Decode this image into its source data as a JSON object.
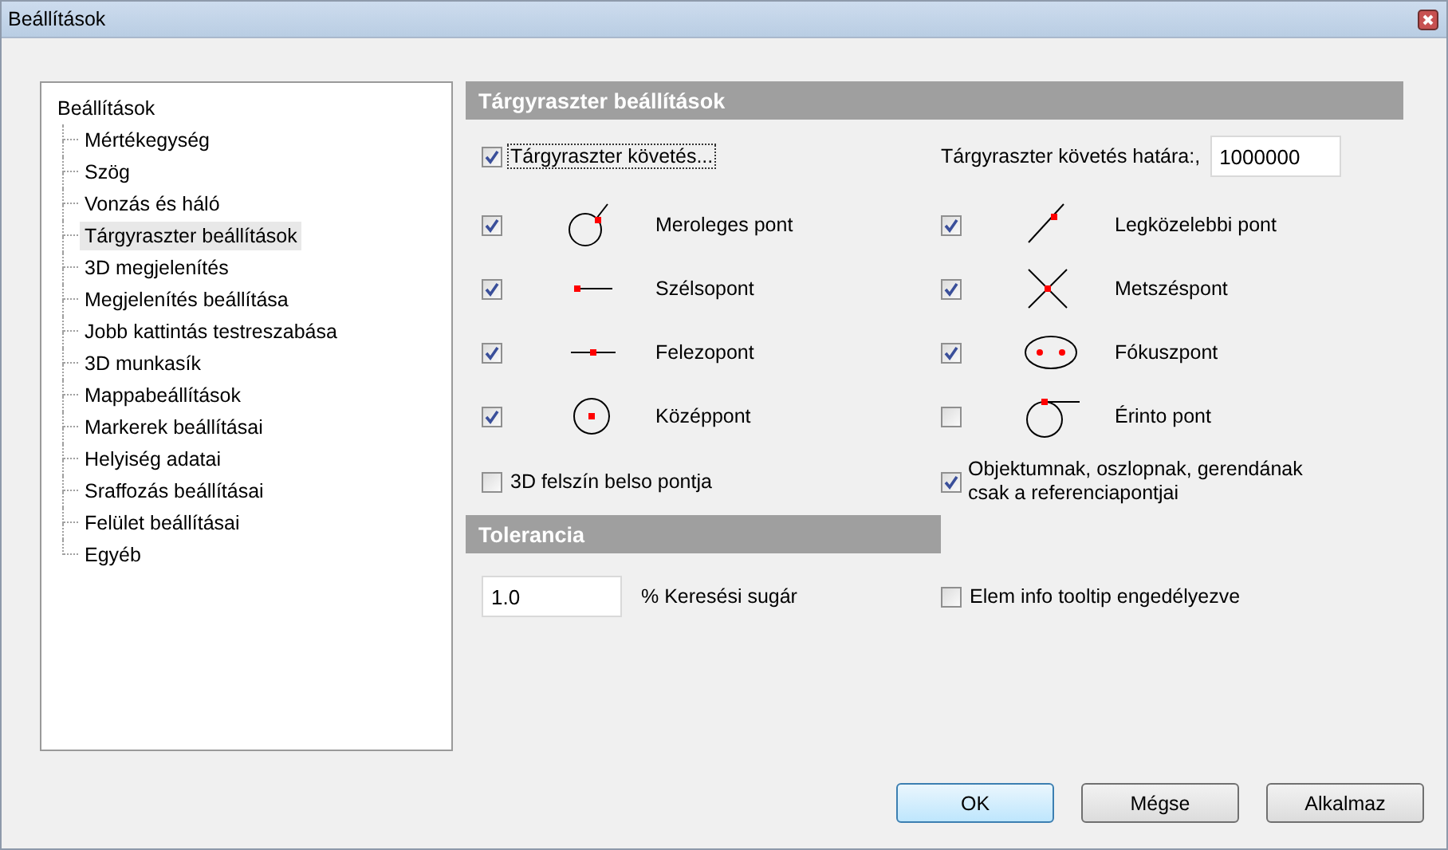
{
  "window": {
    "title": "Beállítások"
  },
  "tree": {
    "root": "Beállítások",
    "children": [
      {
        "label": "Mértékegység",
        "selected": false
      },
      {
        "label": "Szög",
        "selected": false
      },
      {
        "label": "Vonzás és háló",
        "selected": false
      },
      {
        "label": "Tárgyraszter beállítások",
        "selected": true
      },
      {
        "label": "3D megjelenítés",
        "selected": false
      },
      {
        "label": "Megjelenítés beállítása",
        "selected": false
      },
      {
        "label": "Jobb kattintás testreszabása",
        "selected": false
      },
      {
        "label": "3D munkasík",
        "selected": false
      },
      {
        "label": "Mappabeállítások",
        "selected": false
      },
      {
        "label": "Markerek beállításai",
        "selected": false
      },
      {
        "label": "Helyiség adatai",
        "selected": false
      },
      {
        "label": "Sraffozás beállításai",
        "selected": false
      },
      {
        "label": "Felület beállításai",
        "selected": false
      },
      {
        "label": "Egyéb",
        "selected": false
      }
    ]
  },
  "snap": {
    "title": "Tárgyraszter beállítások",
    "tracking": {
      "label": "Tárgyraszter követés...",
      "checked": true,
      "focused": true
    },
    "limit": {
      "label": "Tárgyraszter követés határa:,",
      "value": "1000000"
    },
    "left": [
      {
        "kind": "perpendicular",
        "label": "Meroleges pont",
        "checked": true
      },
      {
        "kind": "endpoint",
        "label": "Szélsopont",
        "checked": true
      },
      {
        "kind": "midpoint",
        "label": "Felezopont",
        "checked": true
      },
      {
        "kind": "center",
        "label": "Középpont",
        "checked": true
      }
    ],
    "right": [
      {
        "kind": "nearest",
        "label": "Legközelebbi pont",
        "checked": true
      },
      {
        "kind": "intersection",
        "label": "Metszéspont",
        "checked": true
      },
      {
        "kind": "focus",
        "label": "Fókuszpont",
        "checked": true
      },
      {
        "kind": "tangent",
        "label": "Érinto pont",
        "checked": false
      }
    ],
    "surface": {
      "label": "3D felszín belso pontja",
      "checked": false
    },
    "objects": {
      "label": "Objektumnak, oszlopnak, gerendának csak a referenciapontjai",
      "checked": true
    }
  },
  "tolerance": {
    "title": "Tolerancia",
    "value": "1.0",
    "label": "% Keresési sugár"
  },
  "tooltip": {
    "label": "Elem info tooltip engedélyezve",
    "checked": false
  },
  "buttons": [
    {
      "label": "OK",
      "default": true
    },
    {
      "label": "Mégse",
      "default": false
    },
    {
      "label": "Alkalmaz",
      "default": false
    }
  ]
}
